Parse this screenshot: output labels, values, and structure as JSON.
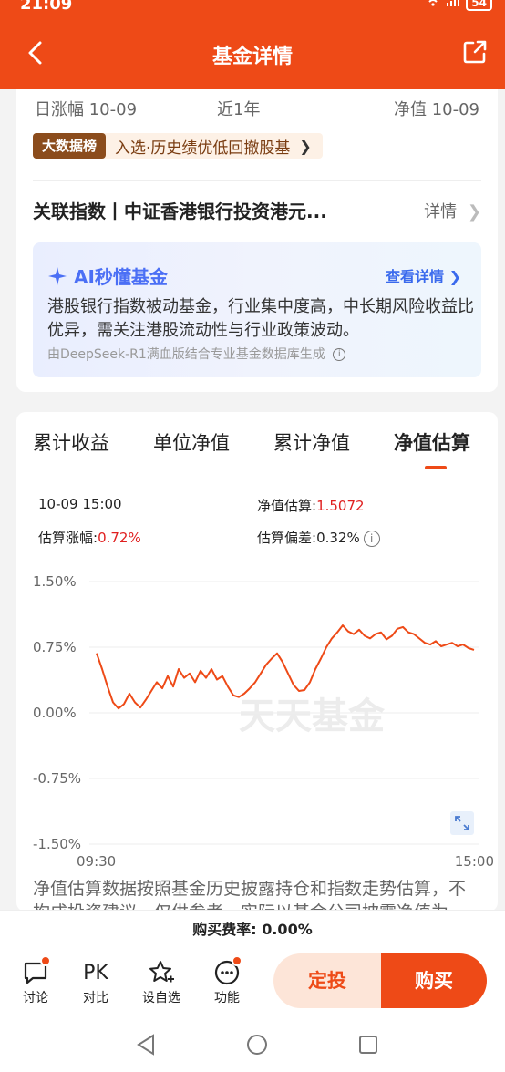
{
  "status": {
    "time": "21:09",
    "battery": "54"
  },
  "header": {
    "title": "基金详情"
  },
  "summary": {
    "daily_change_label": "日涨幅 10-09",
    "period_label": "近1年",
    "nav_label": "净值 10-09"
  },
  "badge": {
    "tag": "大数据榜",
    "text": "入选·历史绩优低回撤股基"
  },
  "index": {
    "name": "关联指数丨中证香港银行投资港元...",
    "detail_label": "详情"
  },
  "ai": {
    "title": "AI秒懂基金",
    "link": "查看详情",
    "body": "港股银行指数被动基金，行业集中度高，中长期风险收益比优异，需关注港股流动性与行业政策波动。",
    "source": "由DeepSeek-R1满血版结合专业基金数据库生成"
  },
  "tabs": [
    {
      "label": "累计收益",
      "active": false
    },
    {
      "label": "单位净值",
      "active": false
    },
    {
      "label": "累计净值",
      "active": false
    },
    {
      "label": "净值估算",
      "active": true
    }
  ],
  "estimate": {
    "time": "10-09 15:00",
    "nav_label": "净值估算:",
    "nav_value": "1.5072",
    "change_label": "估算涨幅:",
    "change_value": "0.72%",
    "deviation_label": "估算偏差:",
    "deviation_value": "0.32%"
  },
  "chart_data": {
    "type": "line",
    "x_start": "09:30",
    "x_end": "15:00",
    "y_ticks": [
      "1.50%",
      "0.75%",
      "0.00%",
      "-0.75%",
      "-1.50%"
    ],
    "ylim": [
      -1.5,
      1.5
    ],
    "watermark": "天天基金",
    "series": [
      {
        "color": "#ee4a17",
        "values": [
          0.68,
          0.5,
          0.3,
          0.12,
          0.05,
          0.1,
          0.22,
          0.12,
          0.06,
          0.15,
          0.25,
          0.35,
          0.28,
          0.42,
          0.3,
          0.5,
          0.4,
          0.45,
          0.35,
          0.48,
          0.4,
          0.5,
          0.38,
          0.42,
          0.3,
          0.2,
          0.18,
          0.22,
          0.28,
          0.35,
          0.45,
          0.55,
          0.62,
          0.68,
          0.58,
          0.45,
          0.32,
          0.25,
          0.26,
          0.35,
          0.5,
          0.62,
          0.75,
          0.85,
          0.92,
          1.0,
          0.93,
          0.9,
          0.95,
          0.88,
          0.85,
          0.9,
          0.92,
          0.84,
          0.88,
          0.96,
          0.98,
          0.92,
          0.9,
          0.85,
          0.8,
          0.78,
          0.82,
          0.76,
          0.78,
          0.8,
          0.76,
          0.78,
          0.74,
          0.72
        ]
      }
    ]
  },
  "footnote": "净值估算数据按照基金历史披露持仓和指数走势估算，不构成投资建议，仅供参考，实际以基金公司披露净值为准。",
  "fee": "购买费率: 0.00%",
  "bottom": {
    "discuss": "讨论",
    "compare_icon": "PK",
    "compare": "对比",
    "watch": "设自选",
    "more": "功能",
    "invest": "定投",
    "buy": "购买"
  }
}
